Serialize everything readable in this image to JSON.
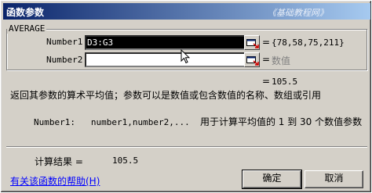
{
  "window": {
    "title": "函数参数",
    "watermark": "《基础教程网》"
  },
  "function_group": {
    "name": "AVERAGE",
    "args": [
      {
        "label": "Number1",
        "value": "D3:G3",
        "result": "{78,58,75,211}"
      },
      {
        "label": "Number2",
        "value": "",
        "result_hint": "数值"
      }
    ],
    "inline_result": "105.5"
  },
  "description": "返回其参数的算术平均值；参数可以是数值或包含数值的名称、数组或引用",
  "param_help": {
    "label": "Number1:",
    "text": "number1,number2,...",
    "desc": "用于计算平均值的 1 到 30 个数值参数"
  },
  "calc_result": {
    "label": "计算结果 =",
    "value": "105.5"
  },
  "help_link": "有关该函数的帮助(H)",
  "buttons": {
    "ok": "确定",
    "cancel": "取消"
  }
}
